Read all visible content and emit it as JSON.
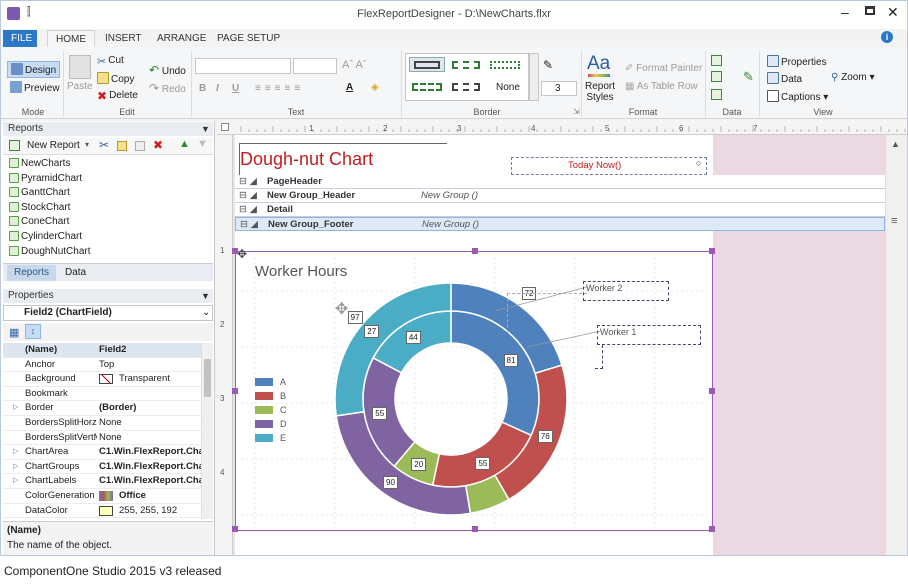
{
  "window": {
    "title": "FlexReportDesigner - D:\\NewCharts.flxr"
  },
  "tabs": [
    "FILE",
    "HOME",
    "INSERT",
    "ARRANGE",
    "PAGE SETUP"
  ],
  "ribbon": {
    "mode": {
      "design": "Design",
      "preview": "Preview",
      "group": "Mode"
    },
    "edit": {
      "paste": "Paste",
      "cut": "Cut",
      "copy": "Copy",
      "delete": "Delete",
      "undo": "Undo",
      "redo": "Redo",
      "group": "Edit"
    },
    "text": {
      "group": "Text"
    },
    "border": {
      "line_style": "None",
      "width_value": "3",
      "group": "Border"
    },
    "format": {
      "report_styles": "Report Styles",
      "format_painter": "Format Painter",
      "as_table_row": "As Table Row",
      "group": "Format"
    },
    "data": {
      "group": "Data"
    },
    "view": {
      "properties": "Properties",
      "data": "Data",
      "captions": "Captions",
      "zoom": "Zoom",
      "group": "View"
    }
  },
  "reports_panel": {
    "title": "Reports",
    "new_report": "New Report",
    "items": [
      "NewCharts",
      "PyramidChart",
      "GanttChart",
      "StockChart",
      "ConeChart",
      "CylinderChart",
      "DoughNutChart"
    ],
    "tabs": [
      "Reports",
      "Data"
    ]
  },
  "properties_panel": {
    "title": "Properties",
    "selected": "Field2 (ChartField)",
    "rows": [
      {
        "name": "(Name)",
        "value": "Field2"
      },
      {
        "name": "Anchor",
        "value": "Top"
      },
      {
        "name": "Background",
        "value": "Transparent"
      },
      {
        "name": "Bookmark",
        "value": ""
      },
      {
        "name": "Border",
        "value": "(Border)"
      },
      {
        "name": "BordersSplitHorz",
        "value": "None"
      },
      {
        "name": "BordersSplitVertM",
        "value": "None"
      },
      {
        "name": "ChartArea",
        "value": "C1.Win.FlexReport.Char"
      },
      {
        "name": "ChartGroups",
        "value": "C1.Win.FlexReport.Char"
      },
      {
        "name": "ChartLabels",
        "value": "C1.Win.FlexReport.Char"
      },
      {
        "name": "ColorGeneration",
        "value": "Office"
      },
      {
        "name": "DataColor",
        "value": "255, 255, 192"
      }
    ],
    "desc_title": "(Name)",
    "desc_text": "The name of the object."
  },
  "designer": {
    "report_title": "Dough-nut Chart",
    "today_field": "Today Now()",
    "bands": [
      {
        "label": "PageHeader",
        "group": ""
      },
      {
        "label": "New Group_Header",
        "group": "New Group ()"
      },
      {
        "label": "Detail",
        "group": ""
      },
      {
        "label": "New Group_Footer",
        "group": "New Group ()"
      }
    ],
    "ruler_marks": [
      "1",
      "2",
      "3",
      "4",
      "5",
      "6",
      "7"
    ],
    "vruler_marks": [
      "1",
      "2",
      "3",
      "4"
    ]
  },
  "chart_data": {
    "type": "doughnut",
    "title": "Worker Hours",
    "categories": [
      "A",
      "B",
      "C",
      "D",
      "E"
    ],
    "series": [
      {
        "name": "Worker 1",
        "values": [
          81,
          55,
          20,
          55,
          44
        ]
      },
      {
        "name": "Worker 2",
        "values": [
          72,
          76,
          20,
          90,
          97
        ]
      }
    ],
    "outer_labels": [
      {
        "label": "Worker 2"
      },
      {
        "label": "Worker 1"
      }
    ],
    "data_labels": [
      {
        "v": "76"
      },
      {
        "v": "81"
      },
      {
        "v": "72"
      },
      {
        "v": "55"
      },
      {
        "v": "20"
      },
      {
        "v": "27"
      },
      {
        "v": "55"
      },
      {
        "v": "44"
      },
      {
        "v": "90"
      },
      {
        "v": "97"
      }
    ],
    "colors": [
      "#4f81bd",
      "#c0504d",
      "#9bbb59",
      "#8064a2",
      "#4bacc6"
    ],
    "legend": "left"
  },
  "caption": "ComponentOne Studio 2015 v3 released"
}
